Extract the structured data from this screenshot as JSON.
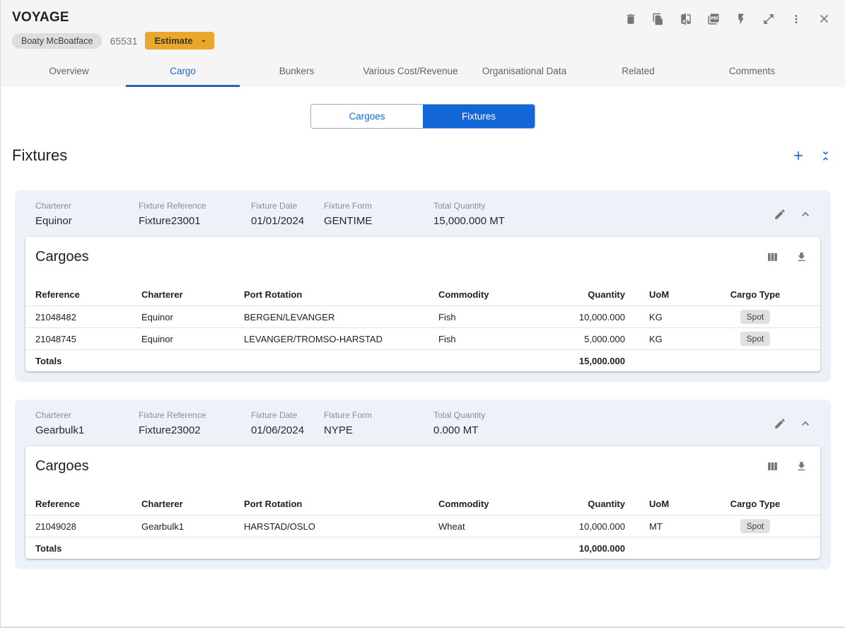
{
  "app": {
    "title": "VOYAGE",
    "chip": "Boaty McBoatface",
    "voyage_id": "65531",
    "estimate_label": "Estimate",
    "toolbar_icons": [
      "delete",
      "duplicate",
      "compare",
      "pdf",
      "quick-actions",
      "expand",
      "more",
      "close"
    ]
  },
  "tabs": [
    {
      "label": "Overview",
      "active": false
    },
    {
      "label": "Cargo",
      "active": true
    },
    {
      "label": "Bunkers",
      "active": false
    },
    {
      "label": "Various Cost/Revenue",
      "active": false
    },
    {
      "label": "Organisational Data",
      "active": false
    },
    {
      "label": "Related",
      "active": false
    },
    {
      "label": "Comments",
      "active": false
    }
  ],
  "view_toggle": {
    "options": [
      {
        "label": "Cargoes",
        "selected": false
      },
      {
        "label": "Fixtures",
        "selected": true
      }
    ]
  },
  "section": {
    "title": "Fixtures"
  },
  "fixtures": [
    {
      "fields": [
        {
          "label": "Charterer",
          "value": "Equinor"
        },
        {
          "label": "Fixture Reference",
          "value": "Fixture23001"
        },
        {
          "label": "Fixture Date",
          "value": "01/01/2024"
        },
        {
          "label": "Fixture Form",
          "value": "GENTIME"
        },
        {
          "label": "Total Quantity",
          "value": "15,000.000 MT"
        }
      ],
      "panel_title": "Cargoes",
      "table": {
        "columns": [
          "Reference",
          "Charterer",
          "Port Rotation",
          "Commodity",
          "Quantity",
          "UoM",
          "Cargo Type"
        ],
        "rows": [
          {
            "reference": "21048482",
            "charterer": "Equinor",
            "port_rotation": "BERGEN/LEVANGER",
            "commodity": "Fish",
            "quantity": "10,000.000",
            "uom": "KG",
            "cargo_type": "Spot"
          },
          {
            "reference": "21048745",
            "charterer": "Equinor",
            "port_rotation": "LEVANGER/TROMSO-HARSTAD",
            "commodity": "Fish",
            "quantity": "5,000.000",
            "uom": "KG",
            "cargo_type": "Spot"
          }
        ],
        "totals": {
          "label": "Totals",
          "quantity": "15,000.000"
        }
      }
    },
    {
      "fields": [
        {
          "label": "Charterer",
          "value": "Gearbulk1"
        },
        {
          "label": "Fixture Reference",
          "value": "Fixture23002"
        },
        {
          "label": "Fixture Date",
          "value": "01/06/2024"
        },
        {
          "label": "Fixture Form",
          "value": "NYPE"
        },
        {
          "label": "Total Quantity",
          "value": "0.000 MT"
        }
      ],
      "panel_title": "Cargoes",
      "table": {
        "columns": [
          "Reference",
          "Charterer",
          "Port Rotation",
          "Commodity",
          "Quantity",
          "UoM",
          "Cargo Type"
        ],
        "rows": [
          {
            "reference": "21049028",
            "charterer": "Gearbulk1",
            "port_rotation": "HARSTAD/OSLO",
            "commodity": "Wheat",
            "quantity": "10,000.000",
            "uom": "MT",
            "cargo_type": "Spot"
          }
        ],
        "totals": {
          "label": "Totals",
          "quantity": "10,000.000"
        }
      }
    }
  ],
  "colors": {
    "accent_blue": "#1266d8",
    "tab_underline": "#2b63b3",
    "estimate_amber": "#e9a82c",
    "card_bg": "#edf2f9",
    "badge_bg": "#e0e0e0",
    "icon_grey": "#757575",
    "header_bg": "#f5f5f5"
  }
}
